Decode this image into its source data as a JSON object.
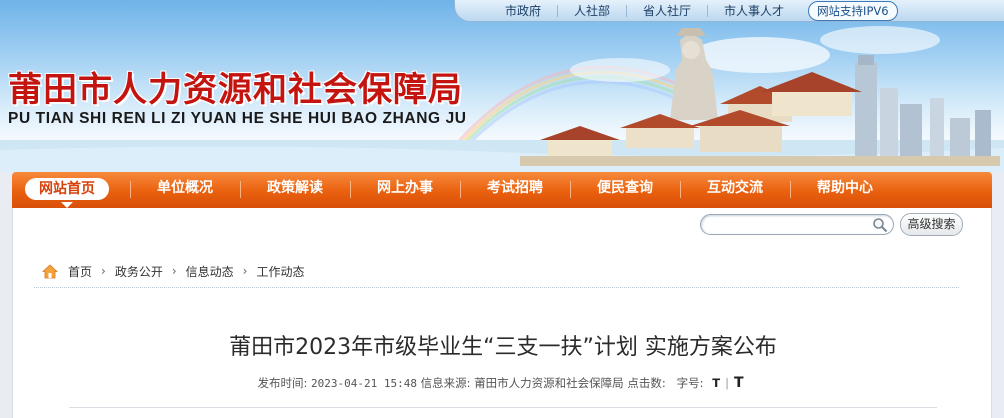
{
  "top_links": [
    "市政府",
    "人社部",
    "省人社厅",
    "市人事人才"
  ],
  "ipv6_label": "网站支持IPV6",
  "site": {
    "title": "莆田市人力资源和社会保障局",
    "pinyin": "PU TIAN SHI REN LI ZI YUAN HE SHE HUI BAO ZHANG JU"
  },
  "nav": {
    "items": [
      "网站首页",
      "单位概况",
      "政策解读",
      "网上办事",
      "考试招聘",
      "便民查询",
      "互动交流",
      "帮助中心"
    ],
    "active_index": 0
  },
  "search": {
    "placeholder": "",
    "advanced_label": "高级搜索"
  },
  "breadcrumb": [
    "首页",
    "政务公开",
    "信息动态",
    "工作动态"
  ],
  "article": {
    "title": "莆田市2023年市级毕业生“三支一扶”计划 实施方案公布",
    "publish_label": "发布时间:",
    "publish_time": "2023-04-21 15:48",
    "source_label": "信息来源:",
    "source": "莆田市人力资源和社会保障局",
    "clicks_label": "点击数:",
    "fontsize_label": "字号:",
    "font_small": "T",
    "font_sep": "|",
    "font_large": "T"
  },
  "colors": {
    "nav_orange": "#e9600e",
    "title_red": "#c4140f",
    "sky_blue": "#6fb3e8"
  }
}
